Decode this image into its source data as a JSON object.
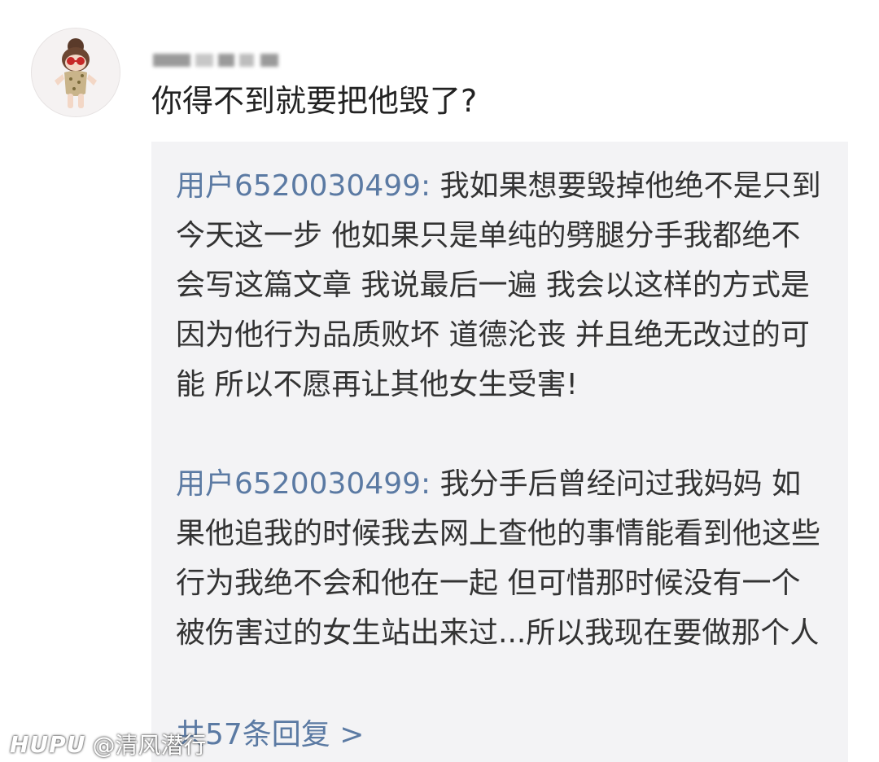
{
  "comment": {
    "avatar_icon": "cartoon-girl-avatar-icon",
    "username_hidden": true,
    "text": "你得不到就要把他毁了?"
  },
  "replies": [
    {
      "user": "用户6520030499",
      "separator": ": ",
      "text": "我如果想要毁掉他绝不是只到今天这一步 他如果只是单纯的劈腿分手我都绝不会写这篇文章 我说最后一遍 我会以这样的方式是因为他行为品质败坏 道德沦丧 并且绝无改过的可能 所以不愿再让其他女生受害!"
    },
    {
      "user": "用户6520030499",
      "separator": ": ",
      "text": "我分手后曾经问过我妈妈 如果他追我的时候我去网上查他的事情能看到他这些行为我绝不会和他在一起 但可惜那时候没有一个被伤害过的女生站出来过...所以我现在要做那个人"
    }
  ],
  "more_replies": "共57条回复 >",
  "watermark": {
    "logo": "HUPU",
    "handle": "@清风潜行"
  },
  "colors": {
    "link_blue": "#5b7aa3",
    "reply_bg": "#f3f3f5",
    "text_dark": "#222222"
  }
}
